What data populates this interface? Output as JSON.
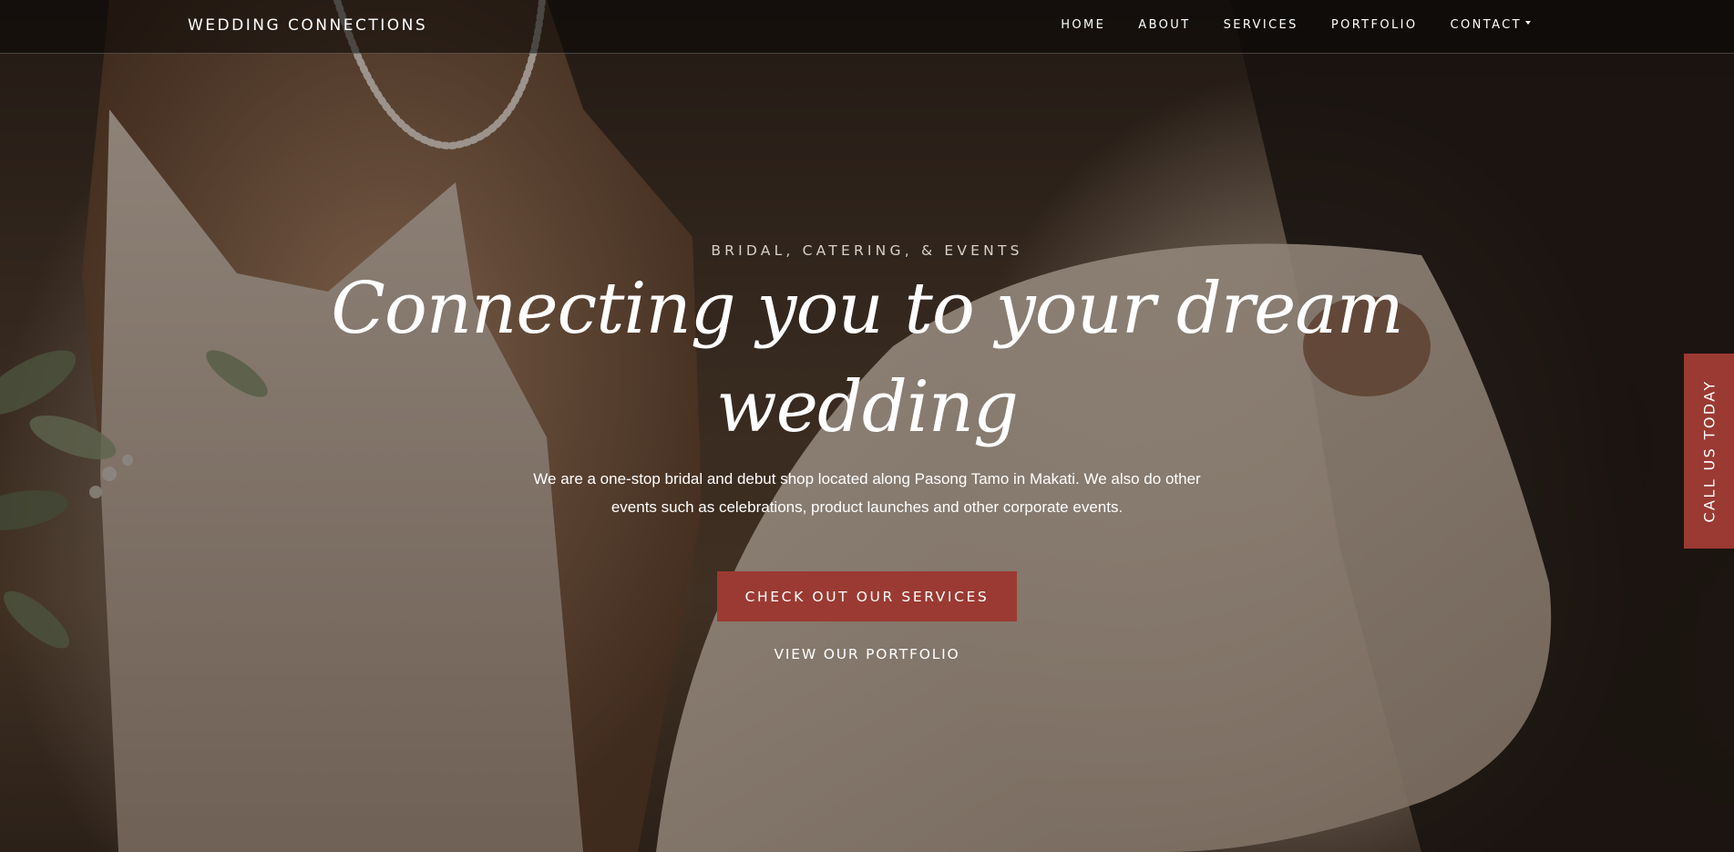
{
  "navbar": {
    "brand": "WEDDING CONNECTIONS",
    "links": [
      {
        "label": "HOME"
      },
      {
        "label": "ABOUT"
      },
      {
        "label": "SERVICES"
      },
      {
        "label": "PORTFOLIO"
      },
      {
        "label": "CONTACT",
        "has_dropdown": true
      }
    ]
  },
  "hero": {
    "eyebrow": "BRIDAL, CATERING, & EVENTS",
    "headline_line1": "Connecting you to your dream",
    "headline_line2": "wedding",
    "lede": "We are a one-stop bridal and debut shop located along Pasong Tamo in Makati. We also do other events such as celebrations, product launches and other corporate events.",
    "primary_cta": "CHECK OUT OUR SERVICES",
    "secondary_cta": "VIEW OUR PORTFOLIO"
  },
  "side_tab": {
    "label": "CALL US TODAY"
  },
  "colors": {
    "accent": "#9b3a32",
    "text": "#ffffff",
    "eyebrow": "#d8d0c8"
  }
}
